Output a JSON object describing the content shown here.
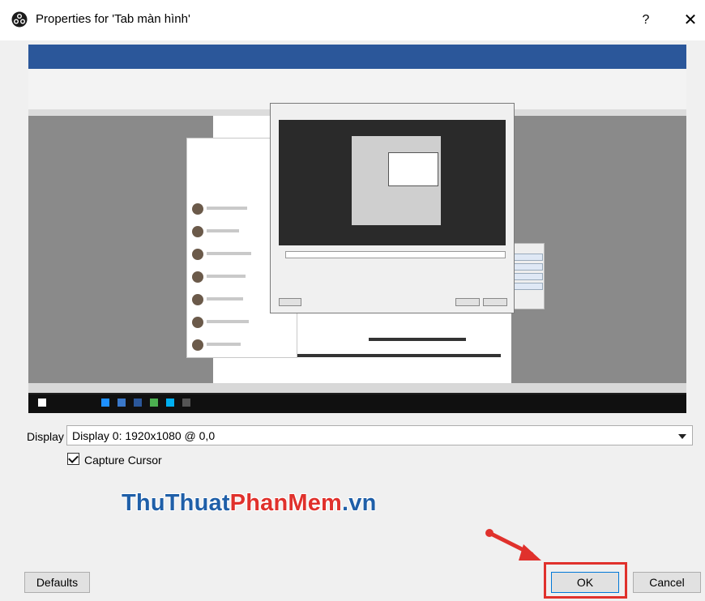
{
  "window": {
    "title": "Properties for 'Tab màn hình'",
    "help_label": "?",
    "close_label": "✕"
  },
  "display": {
    "label": "Display",
    "selected": "Display 0: 1920x1080 @ 0,0"
  },
  "capture_cursor": {
    "label": "Capture Cursor",
    "checked": true
  },
  "watermark": {
    "part1": "ThuThuat",
    "part2": "PhanMem",
    "part3": ".vn"
  },
  "buttons": {
    "defaults": "Defaults",
    "ok": "OK",
    "cancel": "Cancel"
  },
  "colors": {
    "highlight": "#e0312c",
    "accent": "#0078d7",
    "word_blue": "#2b579a"
  }
}
